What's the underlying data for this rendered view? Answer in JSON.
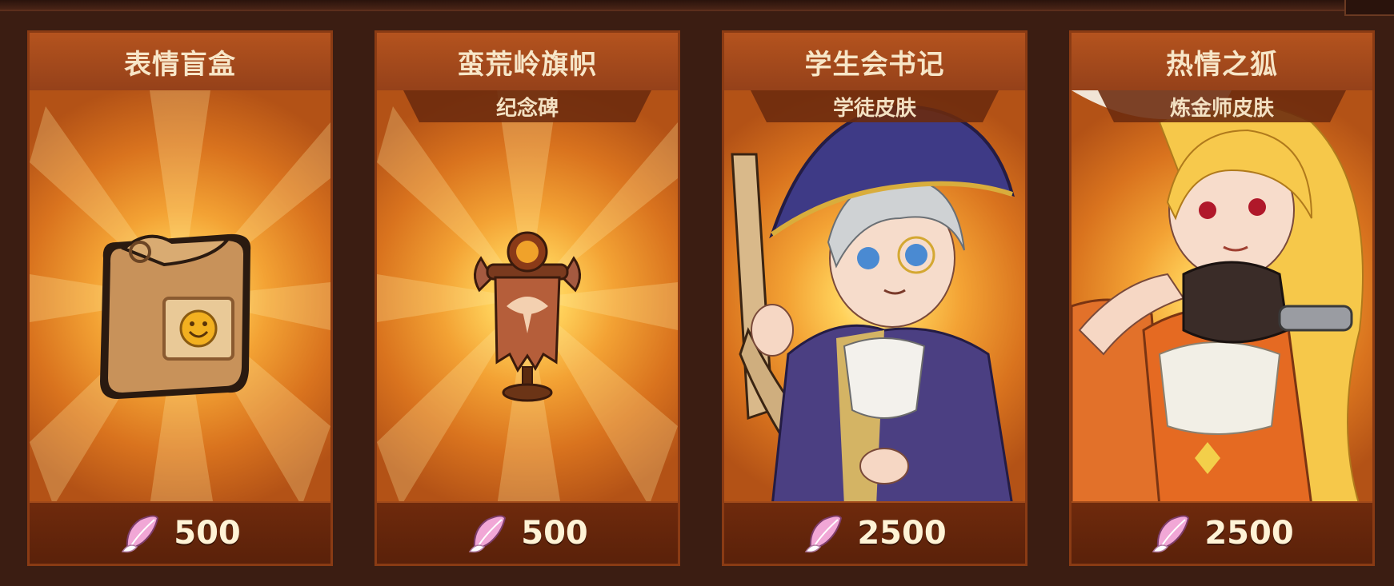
{
  "shop": {
    "cards": [
      {
        "title": "表情盲盒",
        "subtitle": "",
        "price": "500",
        "currency_icon": "feather-icon",
        "art_icon": "emote-blind-box-icon"
      },
      {
        "title": "蛮荒岭旗帜",
        "subtitle": "纪念碑",
        "price": "500",
        "currency_icon": "feather-icon",
        "art_icon": "banner-monument-icon"
      },
      {
        "title": "学生会书记",
        "subtitle": "学徒皮肤",
        "price": "2500",
        "currency_icon": "feather-icon",
        "art_icon": "student-secretary-portrait"
      },
      {
        "title": "热情之狐",
        "subtitle": "炼金师皮肤",
        "price": "2500",
        "currency_icon": "feather-icon",
        "art_icon": "passionate-fox-portrait"
      }
    ]
  },
  "colors": {
    "card_border": "#8a3b14",
    "title_bar": "#b4531e",
    "price_bar": "#5a210a",
    "text_light": "#f7e6c8",
    "background": "#3b1d12"
  }
}
